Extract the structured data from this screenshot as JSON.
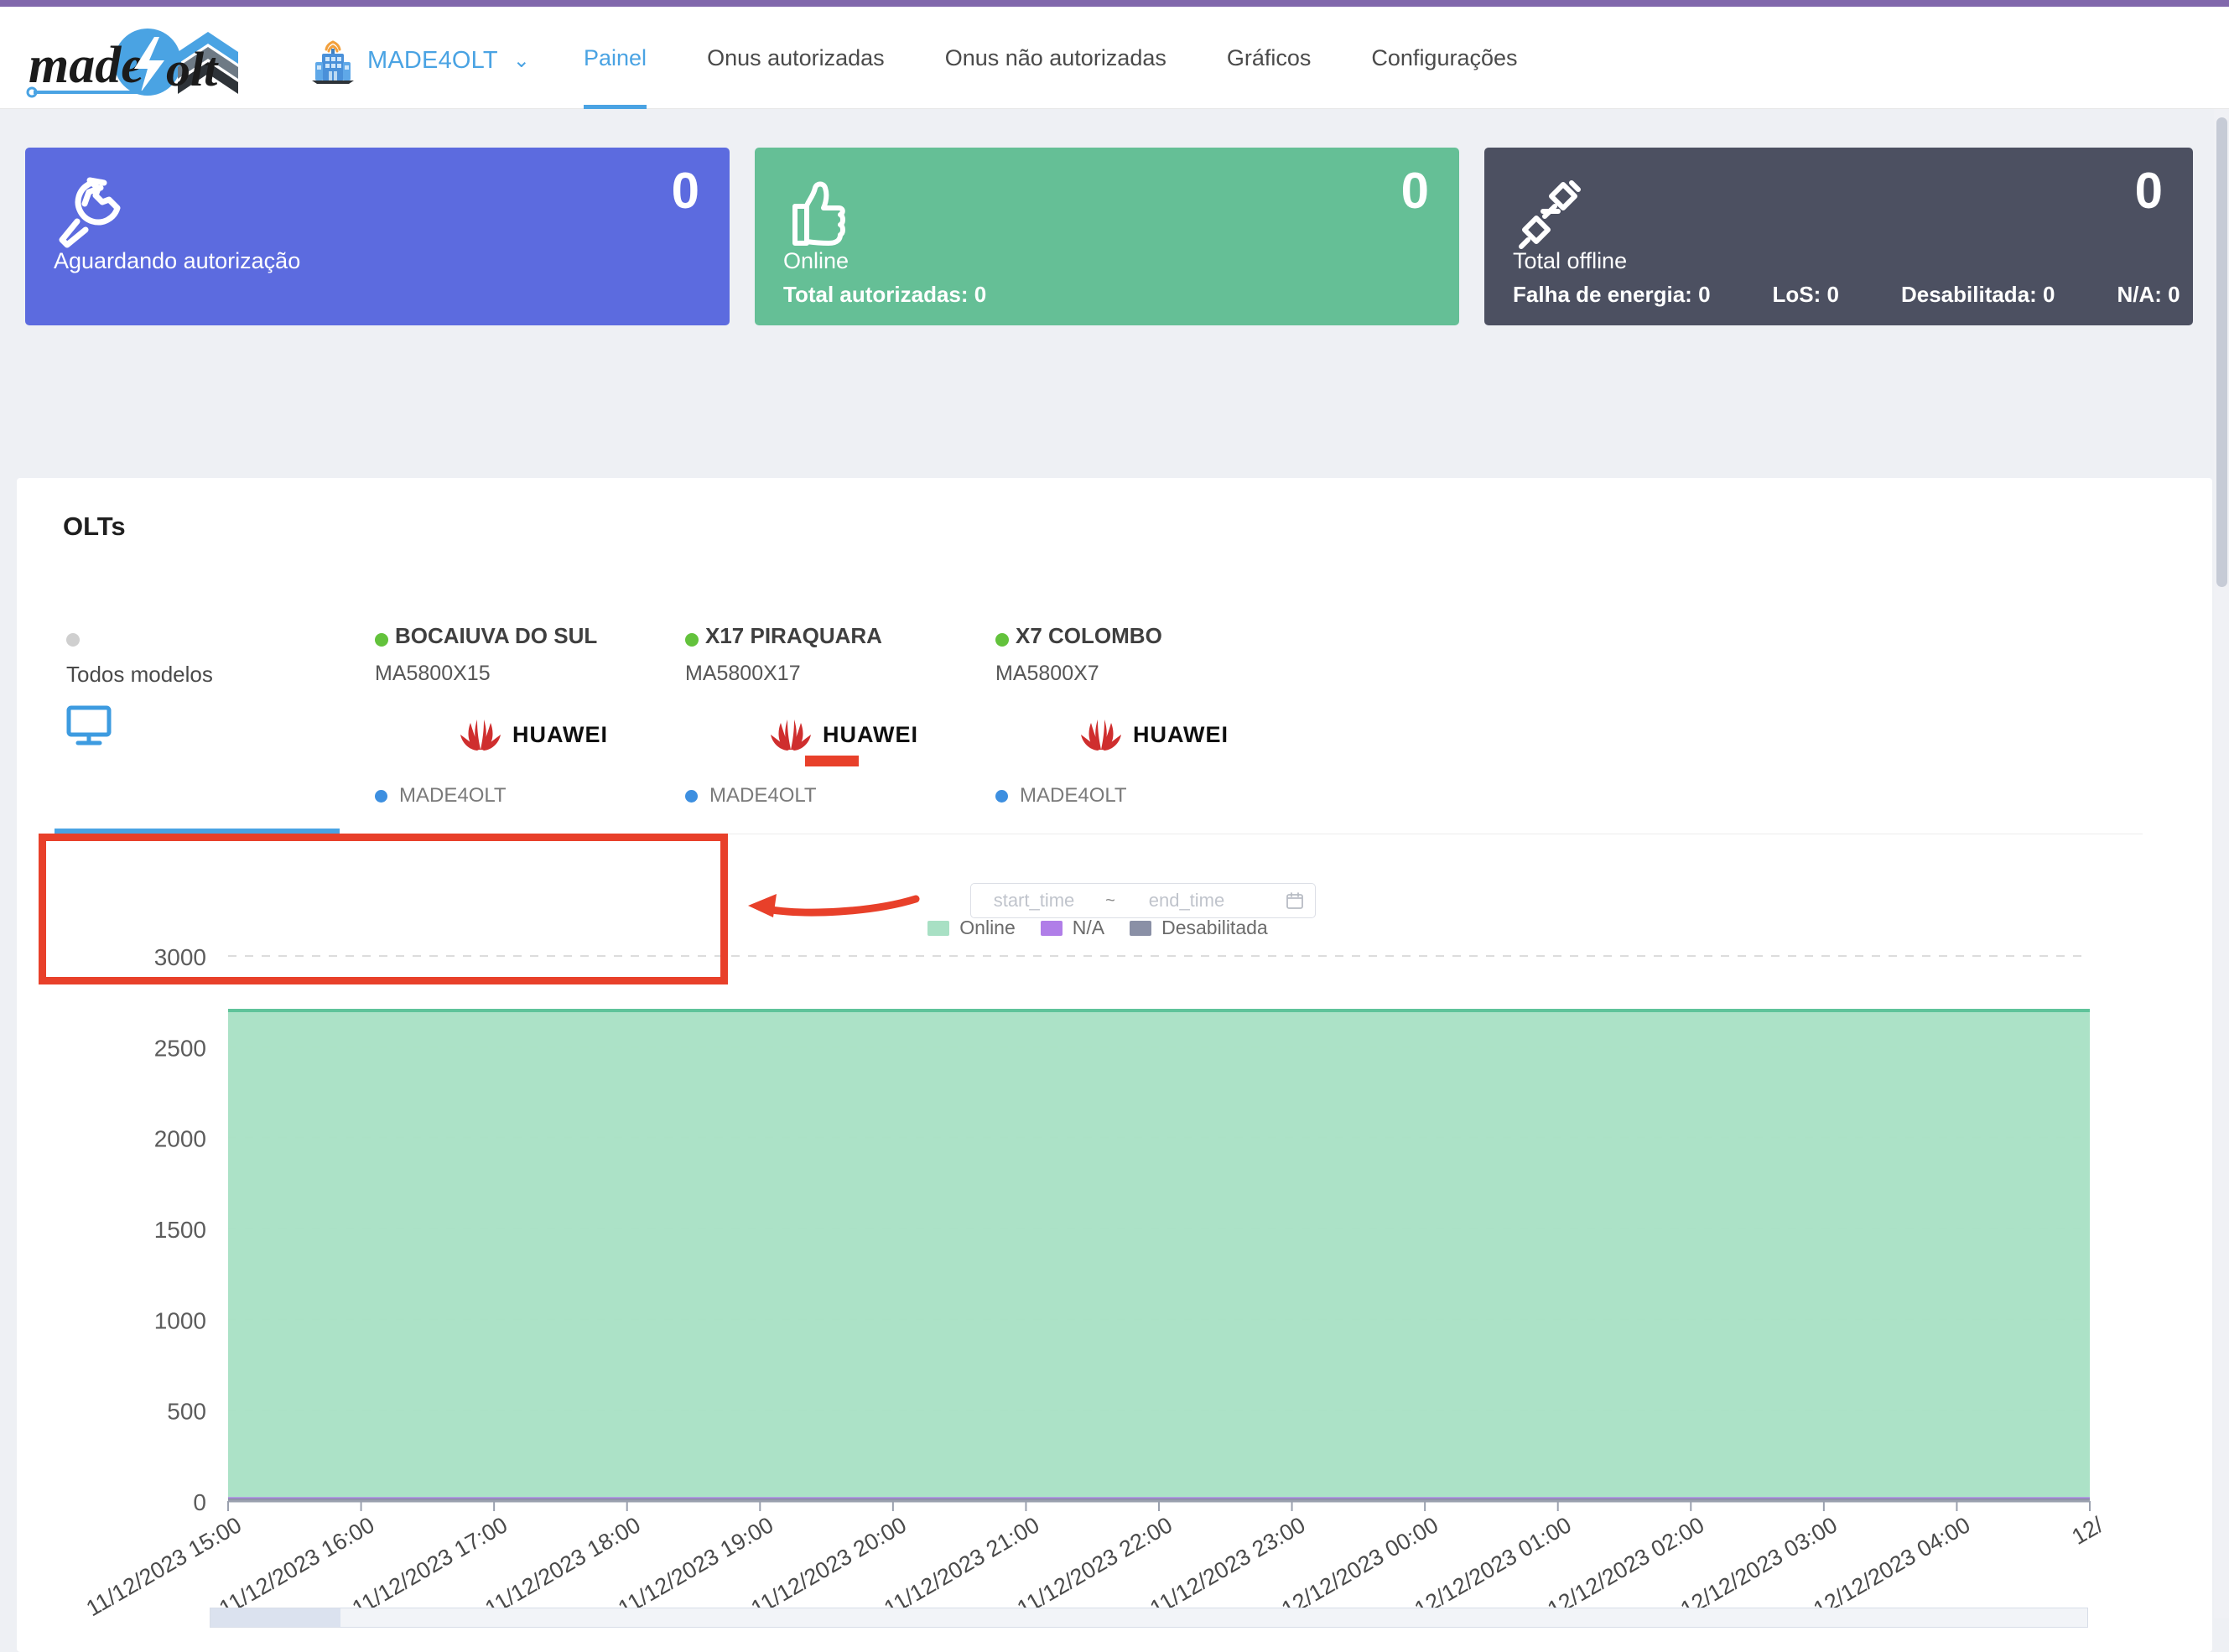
{
  "brand": {
    "logo_text_made": "made",
    "logo_text_olt": "olt",
    "logo_digit": "4"
  },
  "header": {
    "org": {
      "name": "MADE4OLT",
      "caret": "⌄",
      "icon": "building-antenna-icon"
    },
    "nav": [
      {
        "label": "Painel",
        "active": true
      },
      {
        "label": "Onus autorizadas",
        "active": false
      },
      {
        "label": "Onus não autorizadas",
        "active": false
      },
      {
        "label": "Gráficos",
        "active": false
      },
      {
        "label": "Configurações",
        "active": false
      }
    ]
  },
  "cards": [
    {
      "id": "aguardando",
      "icon": "wrench-icon",
      "count": "0",
      "title": "Aguardando autorização",
      "color": "#5c6bdf"
    },
    {
      "id": "online",
      "icon": "thumbs-up-icon",
      "count": "0",
      "title": "Online",
      "subtitle": "Total autorizadas: 0",
      "color": "#65bf96"
    },
    {
      "id": "offline",
      "icon": "unplugged-icon",
      "count": "0",
      "title": "Total offline",
      "color": "#4c5061",
      "stats": [
        "Falha de energia: 0",
        "LoS: 0",
        "Desabilitada: 0",
        "N/A: 0"
      ]
    }
  ],
  "olts_panel": {
    "title": "OLTs",
    "items": [
      {
        "name": "",
        "models_label": "Todos modelos",
        "status": "grey",
        "icon": "monitor-icon",
        "is_all_models": true,
        "active": true
      },
      {
        "name": "BOCAIUVA DO SUL",
        "model": "MA5800X15",
        "status": "green",
        "brand": "HUAWEI",
        "owner": "MADE4OLT",
        "brand_underline": false
      },
      {
        "name": "X17 PIRAQUARA",
        "model": "MA5800X17",
        "status": "green",
        "brand": "HUAWEI",
        "owner": "MADE4OLT",
        "brand_underline": true
      },
      {
        "name": "X7 COLOMBO",
        "model": "MA5800X7",
        "status": "green",
        "brand": "HUAWEI",
        "owner": "MADE4OLT",
        "brand_underline": false
      }
    ]
  },
  "date_range": {
    "start_placeholder": "start_time",
    "end_placeholder": "end_time",
    "start_value": "",
    "end_value": "",
    "separator": "~",
    "calendar_icon": "calendar-icon"
  },
  "annotation": {
    "box_color": "#e8402a",
    "arrow_color": "#e8402a",
    "arrow_direction": "left"
  },
  "chart_data": {
    "type": "area",
    "title": "",
    "xlabel": "",
    "ylabel": "",
    "ylim": [
      0,
      3000
    ],
    "yticks": [
      0,
      500,
      1000,
      1500,
      2000,
      2500,
      3000
    ],
    "ytick_labels": [
      "0",
      "500",
      "1000",
      "1500",
      "2000",
      "2500",
      "3000"
    ],
    "grid": true,
    "legend_position": "bottom",
    "x": [
      "11/12/2023 15:00",
      "11/12/2023 16:00",
      "11/12/2023 17:00",
      "11/12/2023 18:00",
      "11/12/2023 19:00",
      "11/12/2023 20:00",
      "11/12/2023 21:00",
      "11/12/2023 22:00",
      "11/12/2023 23:00",
      "12/12/2023 00:00",
      "12/12/2023 01:00",
      "12/12/2023 02:00",
      "12/12/2023 03:00",
      "12/12/2023 04:00",
      "12/"
    ],
    "series": [
      {
        "name": "Online",
        "color": "#a8e0c4",
        "line_color": "#5fc39a",
        "values": [
          2700,
          2700,
          2700,
          2700,
          2700,
          2700,
          2700,
          2700,
          2700,
          2700,
          2700,
          2700,
          2700,
          2700,
          2700
        ]
      },
      {
        "name": "N/A",
        "color": "#b07ee8",
        "line_color": "#b07ee8",
        "values": [
          12,
          12,
          12,
          12,
          12,
          12,
          12,
          12,
          12,
          12,
          12,
          12,
          12,
          12,
          12
        ]
      },
      {
        "name": "Desabilitada",
        "color": "#8a90a6",
        "line_color": "#8a90a6",
        "values": [
          6,
          6,
          6,
          6,
          6,
          6,
          6,
          6,
          6,
          6,
          6,
          6,
          6,
          6,
          6
        ]
      }
    ],
    "legend": [
      "Online",
      "N/A",
      "Desabilitada"
    ]
  }
}
